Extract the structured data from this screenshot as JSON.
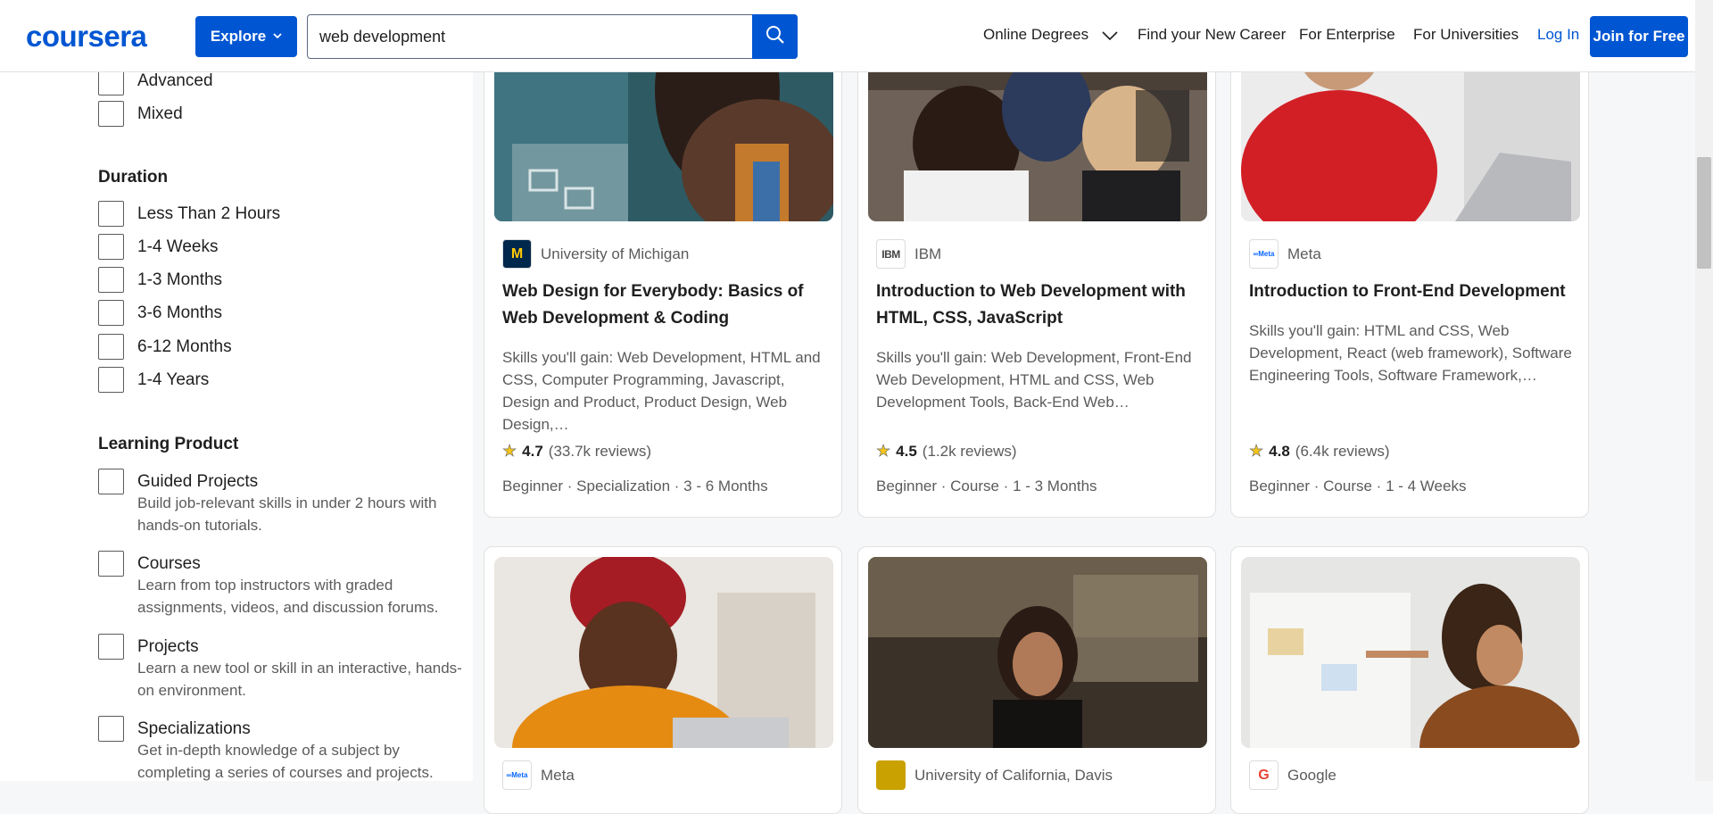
{
  "header": {
    "logo": "coursera",
    "explore_label": "Explore",
    "search_value": "web development",
    "nav": {
      "online_degrees": "Online Degrees",
      "find_career": "Find your New Career",
      "for_enterprise": "For Enterprise",
      "for_universities": "For Universities",
      "login": "Log In",
      "join": "Join for Free"
    }
  },
  "filters": {
    "level_items": [
      "Advanced",
      "Mixed"
    ],
    "duration": {
      "title": "Duration",
      "items": [
        "Less Than 2 Hours",
        "1-4 Weeks",
        "1-3 Months",
        "3-6 Months",
        "6-12 Months",
        "1-4 Years"
      ]
    },
    "learning_product": {
      "title": "Learning Product",
      "items": [
        {
          "label": "Guided Projects",
          "desc": "Build job-relevant skills in under 2 hours with hands-on tutorials."
        },
        {
          "label": "Courses",
          "desc": "Learn from top instructors with graded assignments, videos, and discussion forums."
        },
        {
          "label": "Projects",
          "desc": "Learn a new tool or skill in an interactive, hands-on environment."
        },
        {
          "label": "Specializations",
          "desc": "Get in-depth knowledge of a subject by completing a series of courses and projects."
        }
      ]
    }
  },
  "cards": [
    {
      "partner": "University of Michigan",
      "partner_logo": "M",
      "title": "Web Design for Everybody: Basics of Web Development & Coding",
      "skills": "Skills you'll gain: Web Development, HTML and CSS, Computer Programming, Javascript, Design and Product, Product Design, Web Design,…",
      "rating": "4.7",
      "reviews": "(33.7k reviews)",
      "meta": "Beginner · Specialization · 3 - 6 Months"
    },
    {
      "partner": "IBM",
      "partner_logo": "IBM",
      "title": "Introduction to Web Development with HTML, CSS, JavaScript",
      "skills": "Skills you'll gain: Web Development, Front-End Web Development, HTML and CSS, Web Development Tools, Back-End Web…",
      "rating": "4.5",
      "reviews": "(1.2k reviews)",
      "meta": "Beginner · Course · 1 - 3 Months"
    },
    {
      "partner": "Meta",
      "partner_logo": "∞Meta",
      "title": "Introduction to Front-End Development",
      "skills": "Skills you'll gain: HTML and CSS, Web Development, React (web framework), Software Engineering Tools, Software Framework,…",
      "rating": "4.8",
      "reviews": "(6.4k reviews)",
      "meta": "Beginner · Course · 1 - 4 Weeks"
    },
    {
      "partner": "Meta",
      "partner_logo": "∞Meta"
    },
    {
      "partner": "University of California, Davis",
      "partner_logo": ""
    },
    {
      "partner": "Google",
      "partner_logo": "G"
    }
  ],
  "colors": {
    "brand_blue": "#0056d2",
    "star": "#f5c518",
    "muted_text": "#5b5b5b"
  }
}
